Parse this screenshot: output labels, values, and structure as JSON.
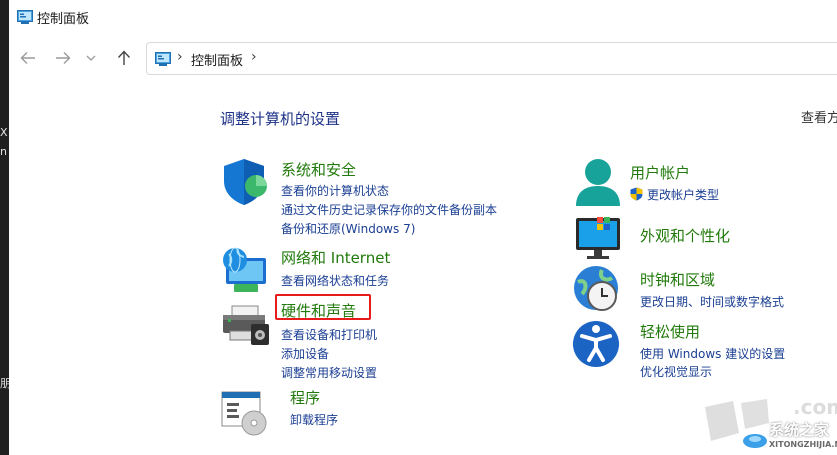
{
  "window": {
    "title": "控制面板"
  },
  "address": {
    "crumb": "控制面板"
  },
  "main": {
    "heading": "调整计算机的设置",
    "view_by": "查看方"
  },
  "left_edge": {
    "chars": [
      "X",
      "n",
      "朋"
    ]
  },
  "categories": {
    "system_security": {
      "title": "系统和安全",
      "links": [
        "查看你的计算机状态",
        "通过文件历史记录保存你的文件备份副本",
        "备份和还原(Windows 7)"
      ]
    },
    "network": {
      "title": "网络和 Internet",
      "links": [
        "查看网络状态和任务"
      ]
    },
    "hardware": {
      "title": "硬件和声音",
      "links": [
        "查看设备和打印机",
        "添加设备",
        "调整常用移动设置"
      ]
    },
    "programs": {
      "title": "程序",
      "links": [
        "卸载程序"
      ]
    },
    "user_accounts": {
      "title": "用户帐户",
      "links": [
        "更改帐户类型"
      ]
    },
    "appearance": {
      "title": "外观和个性化",
      "links": []
    },
    "clock_region": {
      "title": "时钟和区域",
      "links": [
        "更改日期、时间或数字格式"
      ]
    },
    "ease_access": {
      "title": "轻松使用",
      "links": [
        "使用 Windows 建议的设置",
        "优化视觉显示"
      ]
    }
  },
  "watermark": {
    "com": ".com",
    "brand": "系统之家",
    "domain": "XITONGZHIJIA.NET"
  },
  "colors": {
    "title_green": "#217a0b",
    "link_blue": "#1b3f93",
    "heading_blue": "#1e3287",
    "highlight_red": "#e81a1a"
  }
}
